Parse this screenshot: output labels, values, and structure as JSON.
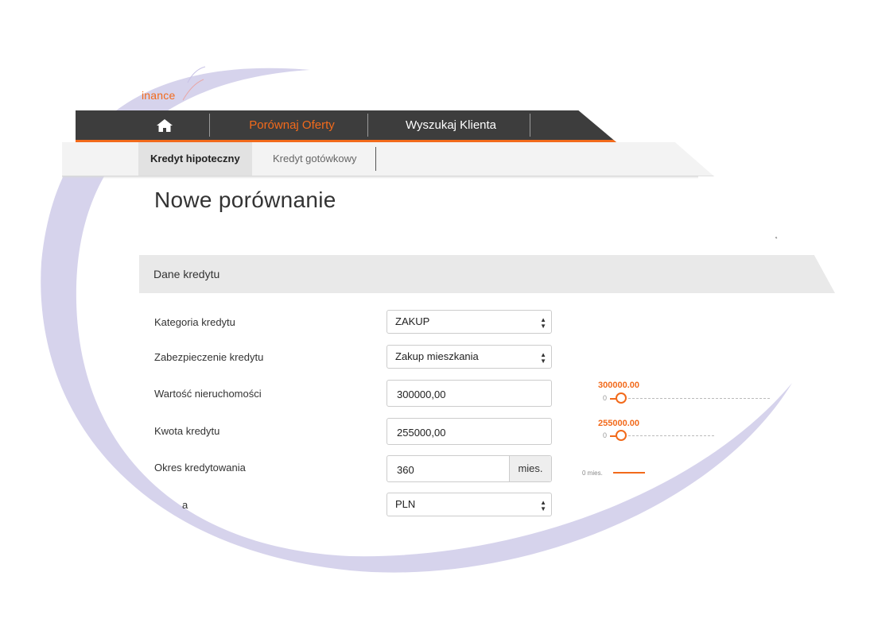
{
  "logo": {
    "text": "inance"
  },
  "topnav": {
    "home_icon": "home-icon",
    "items": [
      {
        "label": "Porównaj Oferty"
      },
      {
        "label": "Wyszukaj Klienta"
      }
    ]
  },
  "subnav": {
    "items": [
      {
        "label": "Kredyt hipoteczny"
      },
      {
        "label": "Kredyt gotówkowy"
      }
    ]
  },
  "page": {
    "title": "Nowe porównanie"
  },
  "section": {
    "title": "Dane kredytu"
  },
  "form": {
    "kategoria": {
      "label": "Kategoria kredytu",
      "value": "ZAKUP"
    },
    "zabezpieczenie": {
      "label": "Zabezpieczenie kredytu",
      "value": "Zakup mieszkania"
    },
    "wartosc": {
      "label": "Wartość nieruchomości",
      "value": "300000,00",
      "slider_value": "300000.00",
      "slider_min": "0"
    },
    "kwota": {
      "label": "Kwota kredytu",
      "value": "255000,00",
      "slider_value": "255000.00",
      "slider_min": "0"
    },
    "okres": {
      "label": "Okres kredytowania",
      "value": "360",
      "unit": "mies.",
      "slider_min": "0 mies."
    },
    "waluta": {
      "label": "a",
      "value": "PLN"
    }
  },
  "colors": {
    "accent": "#f26a1b",
    "nav_bg": "#3d3d3d",
    "swoosh": "#d6d3ec"
  }
}
